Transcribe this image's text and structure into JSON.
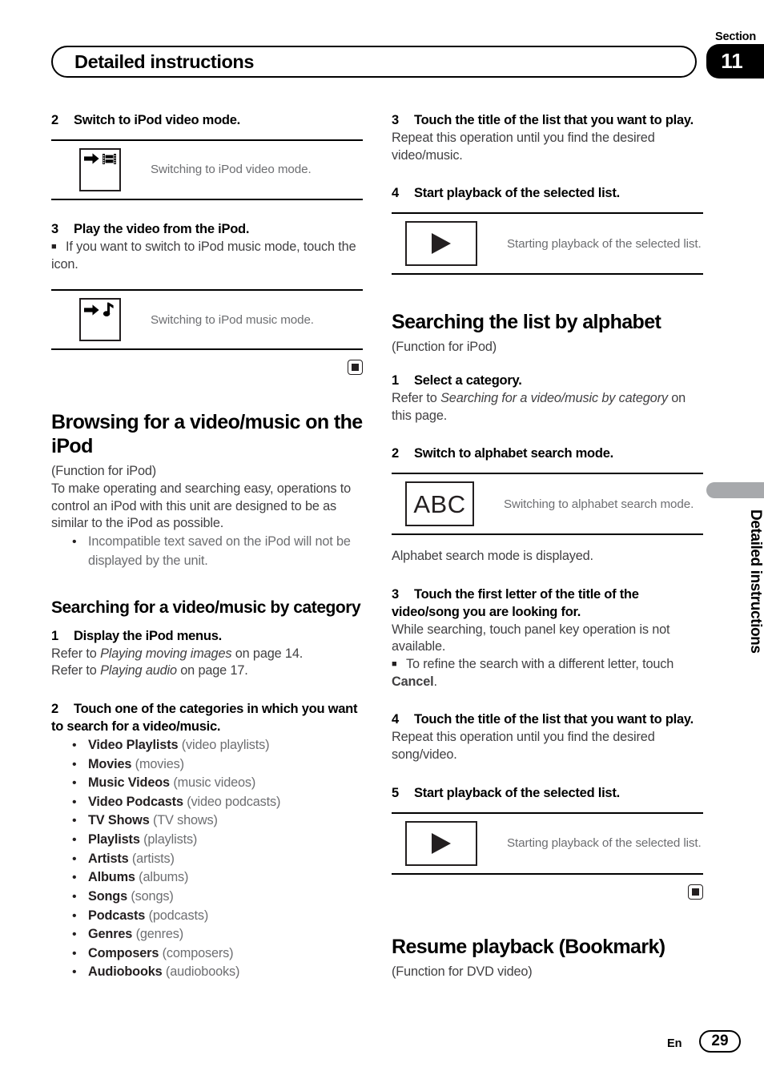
{
  "header": {
    "section_word": "Section",
    "section_number": "11",
    "running_title": "Detailed instructions"
  },
  "side_tab": {
    "label": "Detailed instructions"
  },
  "footer": {
    "language": "En",
    "page_number": "29"
  },
  "left_column": {
    "step2": {
      "num": "2",
      "text": "Switch to iPod video mode."
    },
    "op_video": {
      "icon": "arrow-film-strip-icon",
      "caption": "Switching to iPod video mode."
    },
    "step3": {
      "num": "3",
      "text": "Play the video from the iPod."
    },
    "note_switch_music": "If you want to switch to iPod music mode, touch the icon.",
    "op_music": {
      "icon": "arrow-music-note-icon",
      "caption": "Switching to iPod music mode."
    },
    "section_heading": "Browsing for a video/music on the iPod",
    "function_note": "(Function for iPod)",
    "intro_paragraph": "To make operating and searching easy, operations to control an iPod with this unit are designed to be as similar to the iPod as possible.",
    "intro_bullet": "Incompatible text saved on the iPod will not be displayed by the unit.",
    "sub_heading": "Searching for a video/music by category",
    "step1": {
      "num": "1",
      "text": "Display the iPod menus."
    },
    "refer_line_1_pre": "Refer to ",
    "refer_line_1_italic": "Playing moving images",
    "refer_line_1_post": " on page 14.",
    "refer_line_2_pre": "Refer to ",
    "refer_line_2_italic": "Playing audio",
    "refer_line_2_post": " on page 17.",
    "step2b": {
      "num": "2",
      "text": "Touch one of the categories in which you want to search for a video/music."
    },
    "categories": [
      {
        "bold": "Video Playlists",
        "paren": "(video playlists)"
      },
      {
        "bold": "Movies",
        "paren": "(movies)"
      },
      {
        "bold": "Music Videos",
        "paren": "(music videos)"
      },
      {
        "bold": "Video Podcasts",
        "paren": "(video podcasts)"
      },
      {
        "bold": "TV Shows",
        "paren": "(TV shows)"
      },
      {
        "bold": "Playlists",
        "paren": "(playlists)"
      },
      {
        "bold": "Artists",
        "paren": "(artists)"
      },
      {
        "bold": "Albums",
        "paren": "(albums)"
      },
      {
        "bold": "Songs",
        "paren": "(songs)"
      },
      {
        "bold": "Podcasts",
        "paren": "(podcasts)"
      },
      {
        "bold": "Genres",
        "paren": "(genres)"
      },
      {
        "bold": "Composers",
        "paren": "(composers)"
      },
      {
        "bold": "Audiobooks",
        "paren": "(audiobooks)"
      }
    ]
  },
  "right_column": {
    "step3": {
      "num": "3",
      "text": "Touch the title of the list that you want to play."
    },
    "step3_body": "Repeat this operation until you find the desired video/music.",
    "step4": {
      "num": "4",
      "text": "Start playback of the selected list."
    },
    "op_play_1": {
      "icon": "play-triangle-icon",
      "caption": "Starting playback of the selected list."
    },
    "section_heading": "Searching the list by alphabet",
    "function_note": "(Function for iPod)",
    "step1": {
      "num": "1",
      "text": "Select a category."
    },
    "refer_pre": "Refer to ",
    "refer_italic": "Searching for a video/music by category",
    "refer_post": " on this page.",
    "step2": {
      "num": "2",
      "text": "Switch to alphabet search mode."
    },
    "op_abc": {
      "icon": "abc-text-icon",
      "icon_text": "ABC",
      "caption": "Switching to alphabet search mode."
    },
    "after_abc": "Alphabet search mode is displayed.",
    "step3b": {
      "num": "3",
      "text": "Touch the first letter of the title of the video/song you are looking for."
    },
    "step3b_body": "While searching, touch panel key operation is not available.",
    "step3b_note_pre": "To refine the search with a different letter, touch ",
    "step3b_note_bold": "Cancel",
    "step3b_note_post": ".",
    "step4b": {
      "num": "4",
      "text": "Touch the title of the list that you want to play."
    },
    "step4b_body": "Repeat this operation until you find the desired song/video.",
    "step5": {
      "num": "5",
      "text": "Start playback of the selected list."
    },
    "op_play_2": {
      "icon": "play-triangle-icon",
      "caption": "Starting playback of the selected list."
    },
    "resume_heading": "Resume playback (Bookmark)",
    "resume_function_note": "(Function for DVD video)"
  }
}
